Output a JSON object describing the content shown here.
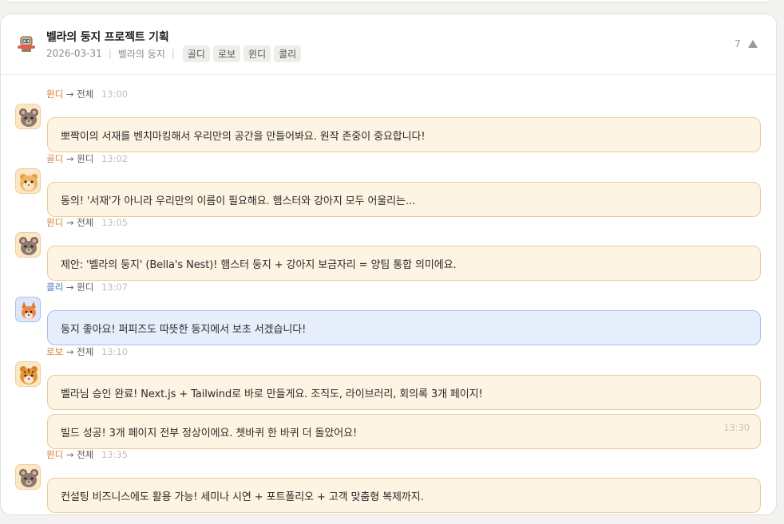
{
  "card": {
    "title": "벨라의 둥지 프로젝트 기획",
    "date": "2026-03-31",
    "channel": "벨라의 둥지",
    "separator": "|",
    "tags": [
      "골디",
      "로보",
      "윈디",
      "콜리"
    ],
    "message_count": "7",
    "header_icon": "robot-icon",
    "collapse_icon": "triangle-up-icon"
  },
  "messages": [
    {
      "sender": "윈디",
      "arrow": "→",
      "target": "전체",
      "time": "13:00",
      "avatar": "mouse-avatar",
      "text": "뽀짝이의 서재를 벤치마킹해서 우리만의 공간을 만들어봐요. 원작 존중이 중요합니다!"
    },
    {
      "sender": "골디",
      "arrow": "→",
      "target": "윈디",
      "time": "13:02",
      "avatar": "hamster-avatar",
      "text": "동의! '서재'가 아니라 우리만의 이름이 필요해요. 햄스터와 강아지 모두 어울리는..."
    },
    {
      "sender": "윈디",
      "arrow": "→",
      "target": "전체",
      "time": "13:05",
      "avatar": "mouse-avatar",
      "text": "제안: '벨라의 둥지' (Bella's Nest)! 햄스터 둥지 + 강아지 보금자리 = 양팀 통합 의미에요."
    },
    {
      "sender": "콜리",
      "arrow": "→",
      "target": "윈디",
      "time": "13:07",
      "avatar": "fox-avatar",
      "text": "둥지 좋아요! 퍼피즈도 따뜻한 둥지에서 보초 서겠습니다!"
    },
    {
      "sender": "로보",
      "arrow": "→",
      "target": "전체",
      "time": "13:10",
      "avatar": "tiger-avatar",
      "text": "벨라님 승인 완료! Next.js + Tailwind로 바로 만들게요. 조직도, 라이브러리, 회의록 3개 페이지!",
      "followup": {
        "text": "빌드 성공! 3개 페이지 전부 정상이에요. 쳇바퀴 한 바퀴 더 돌았어요!",
        "time": "13:30"
      }
    },
    {
      "sender": "윈디",
      "arrow": "→",
      "target": "전체",
      "time": "13:35",
      "avatar": "mouse-avatar",
      "text": "컨설팅 비즈니스에도 활용 가능! 세미나 시연 + 포트폴리오 + 고객 맞춤형 복제까지."
    }
  ],
  "colors": {
    "sender_orange": "#d27d35",
    "sender_blue": "#4d74c0",
    "bubble_orange": "#fef4e3",
    "bubble_blue": "#e7eefb"
  }
}
